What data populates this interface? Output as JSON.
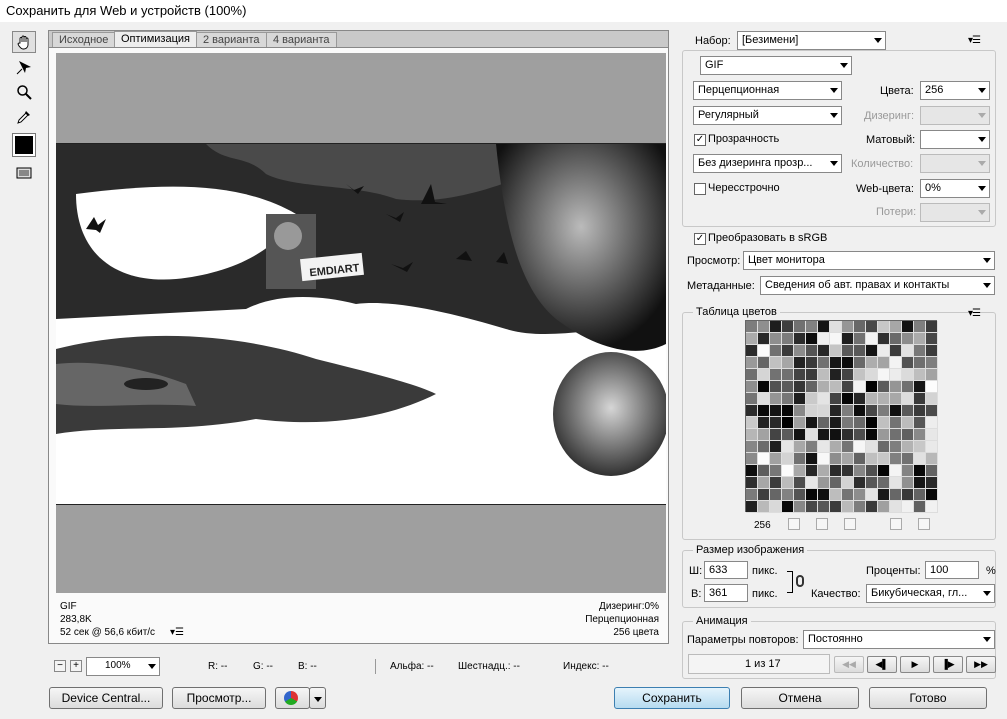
{
  "window": {
    "title": "Сохранить для Web и устройств (100%)"
  },
  "tabs": [
    "Исходное",
    "Оптимизация",
    "2 варианта",
    "4 варианта"
  ],
  "image_overlay": {
    "badge": "EMDIART"
  },
  "info_left": {
    "format": "GIF",
    "size": "283,8K",
    "time": "52 сек @ 56,6 кбит/с"
  },
  "info_right": {
    "dither": "Дизеринг:0%",
    "palette": "Перцепционная",
    "colors": "256 цвета"
  },
  "statusbar": {
    "zoom": "100%",
    "r": "R: --",
    "g": "G: --",
    "b": "B: --",
    "alpha": "Альфа: --",
    "hex": "Шестнадц.: --",
    "index": "Индекс: --"
  },
  "settings": {
    "preset_label": "Набор:",
    "preset": "[Безимени]",
    "format": "GIF",
    "reduction": "Перцепционная",
    "dither_algo": "Регулярный",
    "colors_label": "Цвета:",
    "colors": "256",
    "dither_label": "Дизеринг:",
    "dither_value": "",
    "transparency_label": "Прозрачность",
    "transparency_checked": true,
    "matte_label": "Матовый:",
    "matte": "",
    "trans_dither": "Без дизеринга прозр...",
    "amount_label": "Количество:",
    "amount": "",
    "interlaced_label": "Чересстрочно",
    "interlaced_checked": false,
    "websnap_label": "Web-цвета:",
    "websnap": "0%",
    "lossy_label": "Потери:",
    "lossy": "",
    "srgb_label": "Преобразовать в sRGB",
    "srgb_checked": true,
    "preview_label": "Просмотр:",
    "preview": "Цвет монитора",
    "metadata_label": "Метаданные:",
    "metadata": "Сведения об авт. правах и контакты"
  },
  "color_table": {
    "title": "Таблица цветов",
    "count": "256"
  },
  "image_size": {
    "title": "Размер изображения",
    "w_label": "Ш:",
    "w": "633",
    "w_unit": "пикс.",
    "h_label": "В:",
    "h": "361",
    "h_unit": "пикс.",
    "percent_label": "Проценты:",
    "percent": "100",
    "percent_unit": "%",
    "quality_label": "Качество:",
    "quality": "Бикубическая, гл..."
  },
  "animation": {
    "title": "Анимация",
    "loop_label": "Параметры повторов:",
    "loop": "Постоянно",
    "frame": "1 из 17"
  },
  "buttons": {
    "device_central": "Device Central...",
    "preview": "Просмотр...",
    "save": "Сохранить",
    "cancel": "Отмена",
    "done": "Готово"
  },
  "icons": [
    "hand-icon",
    "slice-select-icon",
    "zoom-icon",
    "eyedropper-icon",
    "eyedropper-color-swatch",
    "toggle-slices-icon",
    "browser-icon"
  ]
}
